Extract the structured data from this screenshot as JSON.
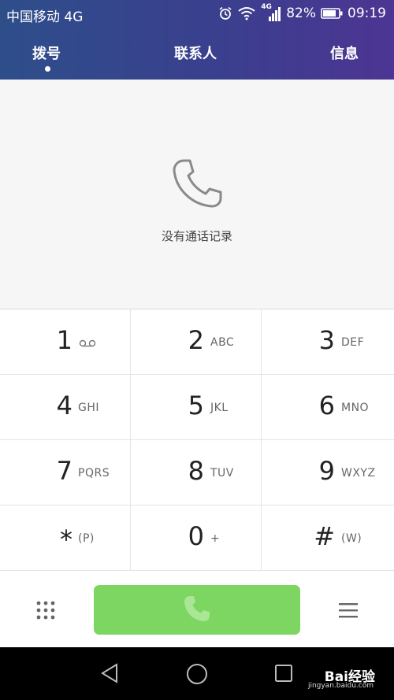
{
  "status_bar": {
    "carrier": "中国移动 4G",
    "network_badge": "4G",
    "battery": "82%",
    "time": "09:19",
    "icons": [
      "alarm-icon",
      "wifi-icon",
      "signal-icon",
      "battery-icon"
    ]
  },
  "tabs": [
    {
      "label": "拨号",
      "active": true
    },
    {
      "label": "联系人",
      "active": false
    },
    {
      "label": "信息",
      "active": false
    }
  ],
  "call_log": {
    "empty_icon": "phone-icon",
    "empty_text": "没有通话记录"
  },
  "keypad": [
    {
      "digit": "1",
      "letters": "",
      "icon": "voicemail-icon"
    },
    {
      "digit": "2",
      "letters": "ABC"
    },
    {
      "digit": "3",
      "letters": "DEF"
    },
    {
      "digit": "4",
      "letters": "GHI"
    },
    {
      "digit": "5",
      "letters": "JKL"
    },
    {
      "digit": "6",
      "letters": "MNO"
    },
    {
      "digit": "7",
      "letters": "PQRS"
    },
    {
      "digit": "8",
      "letters": "TUV"
    },
    {
      "digit": "9",
      "letters": "WXYZ"
    },
    {
      "digit": "*",
      "letters": "(P)"
    },
    {
      "digit": "0",
      "letters": "+"
    },
    {
      "digit": "#",
      "letters": "(W)"
    }
  ],
  "actions": {
    "left_icon": "dialpad-icon",
    "call_icon": "phone-icon",
    "right_icon": "menu-icon",
    "call_color": "#7dd661"
  },
  "nav_bar": {
    "icons": [
      "back-icon",
      "home-icon",
      "recents-icon"
    ]
  },
  "watermark": {
    "brand": "Bai经验",
    "url": "jingyan.baidu.com"
  },
  "colors": {
    "header_start": "#2e4e8a",
    "header_end": "#4d3593"
  }
}
